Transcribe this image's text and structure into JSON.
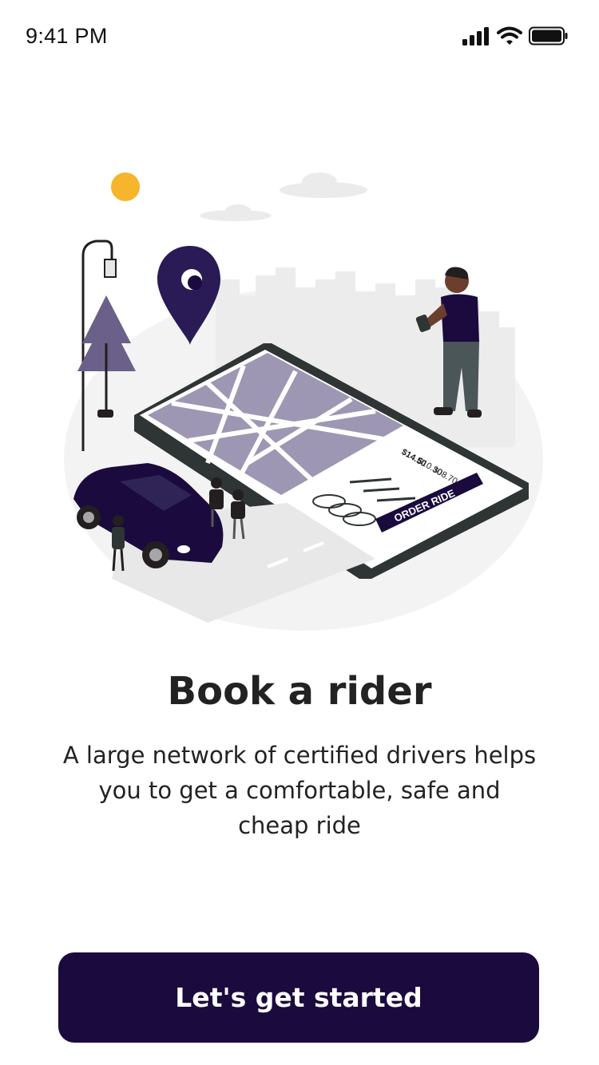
{
  "status_bar": {
    "time": "9:41 PM",
    "icons": [
      "cellular-signal-icon",
      "wifi-icon",
      "battery-icon"
    ]
  },
  "illustration": {
    "prices": [
      "$14.50",
      "$10.30",
      "$08.70"
    ],
    "order_button_label": "ORDER RIDE"
  },
  "onboarding": {
    "title": "Book a rider",
    "description": "A large network of certified drivers helps you to get a comfortable, safe and cheap ride",
    "cta_label": "Let's get started"
  },
  "colors": {
    "primary": "#1b0a3e",
    "accent_sun": "#f7b52b",
    "map_block": "#9e97b3"
  }
}
